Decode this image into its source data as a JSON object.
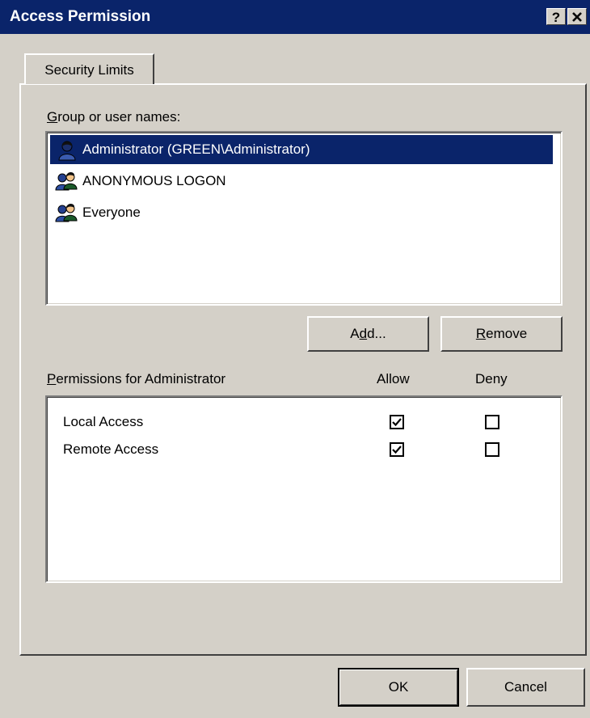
{
  "window": {
    "title": "Access Permission",
    "help_label": "?",
    "close_label": "✕"
  },
  "tab": {
    "label": "Security Limits"
  },
  "users": {
    "label_prefix": "G",
    "label_rest": "roup or user names:",
    "items": [
      {
        "name": "Administrator (GREEN\\Administrator)",
        "icon": "user-icon",
        "selected": true
      },
      {
        "name": "ANONYMOUS LOGON",
        "icon": "group-icon",
        "selected": false
      },
      {
        "name": "Everyone",
        "icon": "group-icon",
        "selected": false
      }
    ]
  },
  "buttons": {
    "add_pre": "A",
    "add_mnemonic": "d",
    "add_post": "d...",
    "remove_mnemonic": "R",
    "remove_post": "emove",
    "ok": "OK",
    "cancel": "Cancel"
  },
  "permissions": {
    "label_prefix": "P",
    "label_rest": "ermissions for Administrator",
    "allow_header": "Allow",
    "deny_header": "Deny",
    "rows": [
      {
        "name": "Local Access",
        "allow": true,
        "deny": false
      },
      {
        "name": "Remote Access",
        "allow": true,
        "deny": false
      }
    ]
  },
  "colors": {
    "titlebar": "#0a246a",
    "face": "#d4d0c8",
    "selection": "#0a246a"
  }
}
